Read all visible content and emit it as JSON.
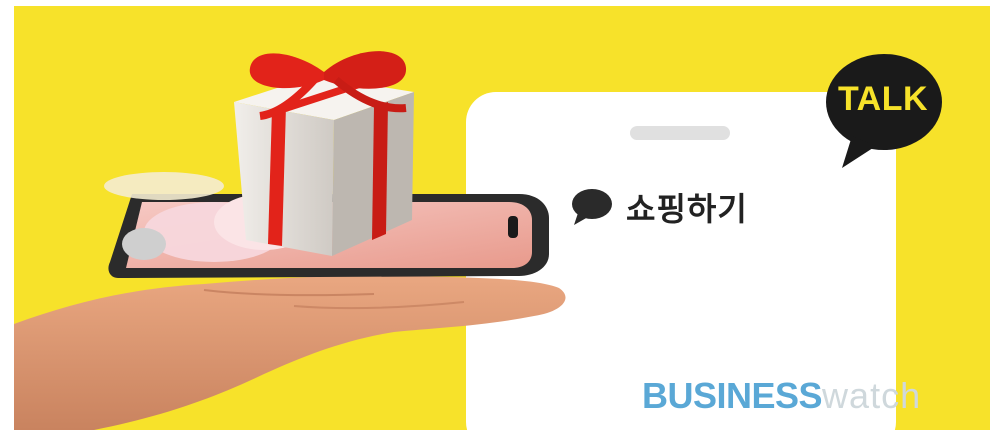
{
  "banner": {
    "menu_label": "쇼핑하기",
    "talk_badge": "TALK",
    "logo": {
      "part1": "BUSINESS",
      "part2": "watch"
    }
  },
  "colors": {
    "background": "#f7e22a",
    "card": "#ffffff",
    "bubble": "#1a1a1a",
    "logo_primary": "#5aa8d6",
    "logo_secondary": "#cfd8dc",
    "ribbon": "#e2231a"
  },
  "icons": [
    "chat-bubble-icon",
    "talk-bubble-icon",
    "gift-box-icon",
    "smartphone-icon",
    "hand-icon"
  ]
}
